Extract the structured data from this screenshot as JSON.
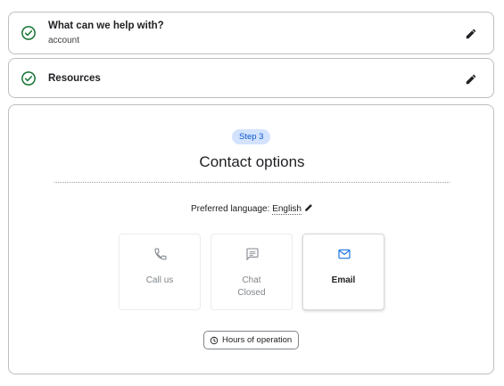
{
  "steps": [
    {
      "title": "What can we help with?",
      "subtitle": "account",
      "status_icon": "check-circle-icon",
      "action_icon": "pencil-icon"
    },
    {
      "title": "Resources",
      "status_icon": "check-circle-icon",
      "action_icon": "pencil-icon"
    }
  ],
  "contact": {
    "step_badge": "Step 3",
    "title": "Contact options",
    "language_label": "Preferred language:",
    "language_value": "English",
    "options": [
      {
        "label": "Call us",
        "icon": "phone-icon",
        "state": "disabled"
      },
      {
        "label": "Chat",
        "status": "Closed",
        "icon": "chat-icon",
        "state": "disabled"
      },
      {
        "label": "Email",
        "icon": "mail-icon",
        "state": "enabled"
      }
    ],
    "hours_button": "Hours of operation"
  },
  "colors": {
    "check_green": "#137333",
    "badge_bg": "#d3e3fd",
    "badge_text": "#0b57d0",
    "accent_blue": "#1a73e8",
    "disabled_gray": "#80868b"
  }
}
